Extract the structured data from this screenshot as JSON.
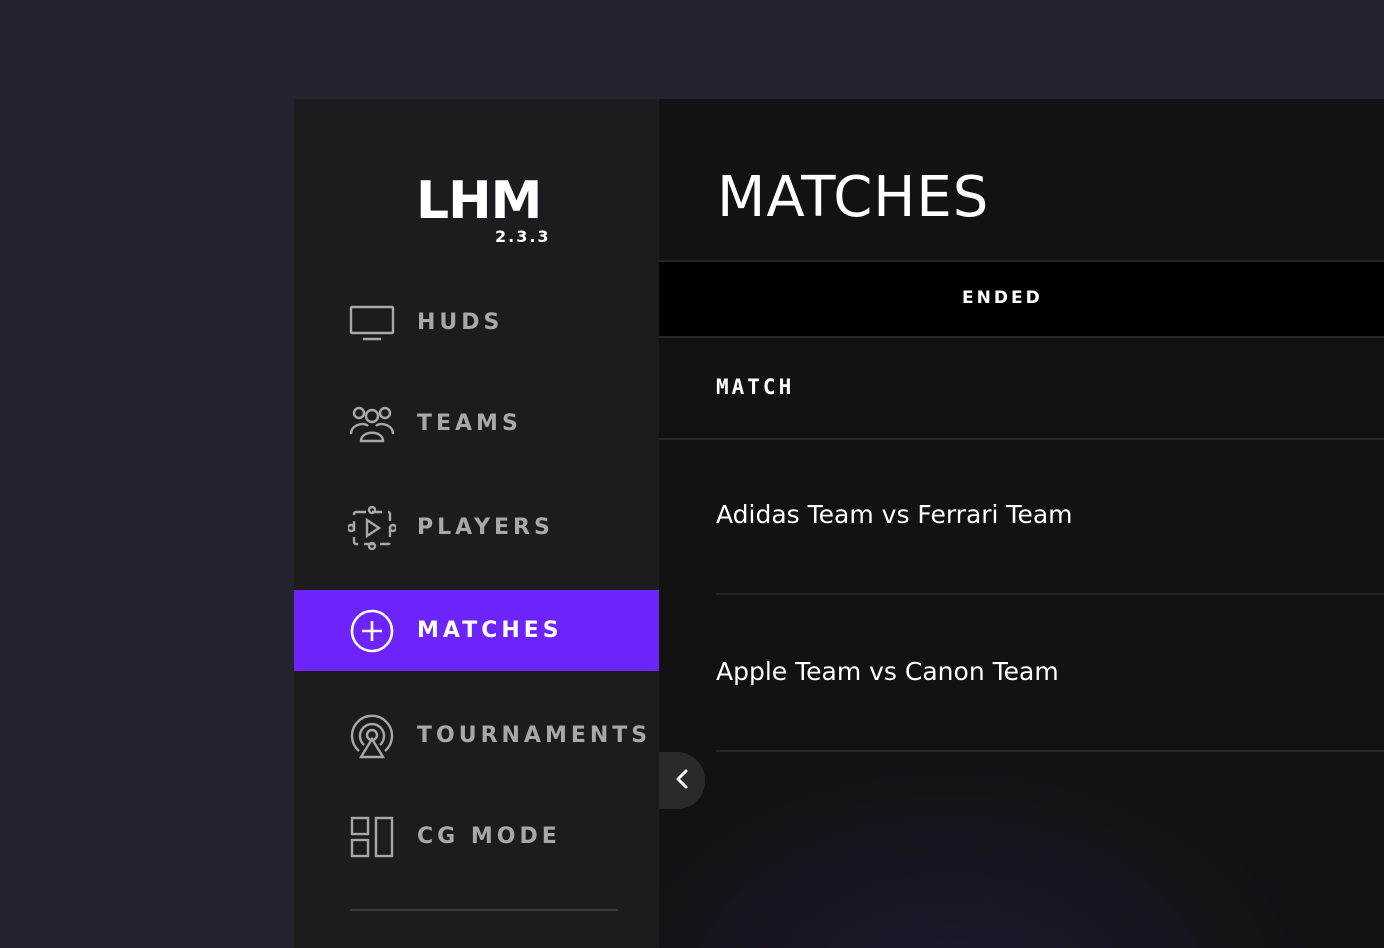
{
  "app": {
    "logo": "LHM",
    "version": "2.3.3"
  },
  "sidebar": {
    "items": [
      {
        "label": "HUDS",
        "icon": "monitor-icon",
        "active": false
      },
      {
        "label": "TEAMS",
        "icon": "users-icon",
        "active": false
      },
      {
        "label": "PLAYERS",
        "icon": "players-icon",
        "active": false
      },
      {
        "label": "MATCHES",
        "icon": "plus-circle-icon",
        "active": true
      },
      {
        "label": "TOURNAMENTS",
        "icon": "broadcast-icon",
        "active": false
      },
      {
        "label": "CG MODE",
        "icon": "layout-icon",
        "active": false
      }
    ],
    "collapse_icon": "chevron-left-icon"
  },
  "main": {
    "title": "MATCHES",
    "tabs": [
      {
        "label": "ENDED",
        "active": true
      }
    ],
    "table": {
      "column_header": "MATCH",
      "rows": [
        {
          "name": "Adidas Team vs Ferrari Team"
        },
        {
          "name": "Apple Team vs Canon Team"
        }
      ]
    }
  },
  "colors": {
    "page_background": "#24232e",
    "sidebar_background": "#1c1c1e",
    "main_background": "#121213",
    "accent": "#6c24fb",
    "tab_bar": "#000000",
    "muted_text": "#a8a8aa"
  }
}
